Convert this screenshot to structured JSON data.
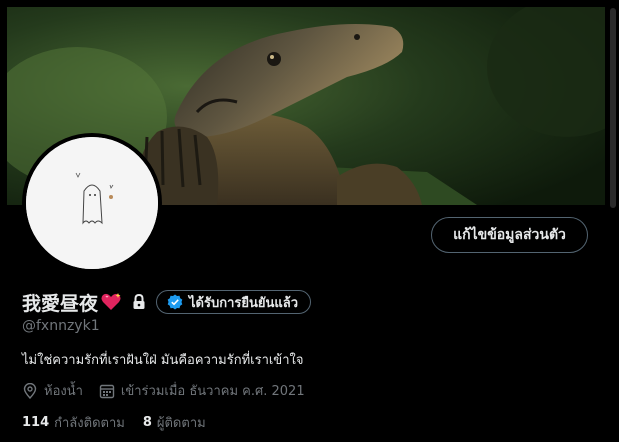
{
  "profile": {
    "display_name": "我愛昼夜",
    "handle": "@fxnnzyk1",
    "bio": "ไม่ใช่ความรักที่เราฝันใฝ่ มันคือความรักที่เราเข้าใจ",
    "location": "ห้องน้ำ",
    "joined": "เข้าร่วมเมื่อ ธันวาคม ค.ศ. 2021"
  },
  "buttons": {
    "edit_profile": "แก้ไขข้อมูลส่วนตัว"
  },
  "verified": {
    "label": "ได้รับการยืนยันแล้ว"
  },
  "stats": {
    "following_count": "114",
    "following_label": "กำลังติดตาม",
    "followers_count": "8",
    "followers_label": "ผู้ติดตาม"
  },
  "icons": {
    "heart": "sparkling-heart-icon",
    "lock": "lock-icon",
    "verified": "verified-badge-icon",
    "location": "location-pin-icon",
    "calendar": "calendar-icon"
  },
  "colors": {
    "background": "#000000",
    "text_primary": "#e7e9ea",
    "text_secondary": "#71767b",
    "border": "#536471",
    "verified_blue": "#1d9bf0",
    "heart_pink": "#e0245e"
  }
}
